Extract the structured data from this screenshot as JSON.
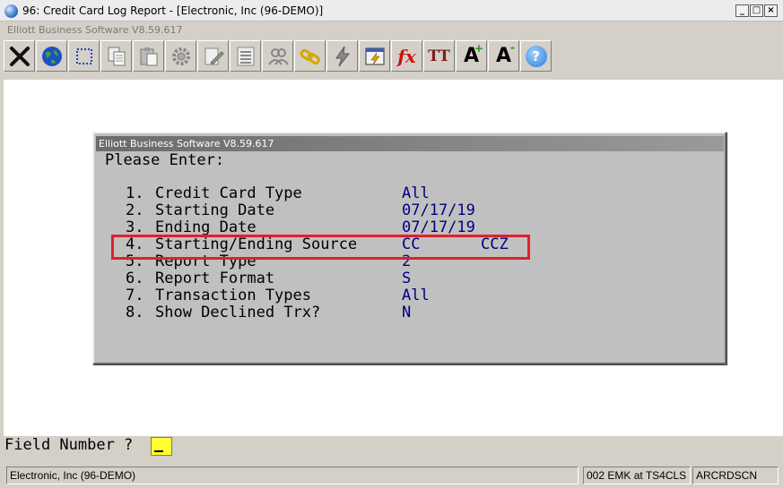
{
  "window": {
    "title": "96: Credit Card Log Report - [Electronic, Inc (96-DEMO)]",
    "subtitle": "Elliott Business Software V8.59.617",
    "buttons": {
      "minimize": "_",
      "maximize": "□",
      "close": "×"
    }
  },
  "toolbar": {
    "buttons": [
      {
        "icon": "close-x-icon"
      },
      {
        "icon": "globe-icon"
      },
      {
        "icon": "select-box-icon"
      },
      {
        "icon": "copy-icon"
      },
      {
        "icon": "paste-icon"
      },
      {
        "icon": "gear-icon"
      },
      {
        "icon": "edit-icon"
      },
      {
        "icon": "list-icon"
      },
      {
        "icon": "users-icon"
      },
      {
        "icon": "link-icon"
      },
      {
        "icon": "lightning-icon"
      },
      {
        "icon": "calendar-icon"
      },
      {
        "icon": "function-icon",
        "label": "fx"
      },
      {
        "icon": "font-size-icon",
        "label": "TT"
      },
      {
        "icon": "font-increase-icon",
        "label": "A"
      },
      {
        "icon": "font-decrease-icon",
        "label": "A"
      },
      {
        "icon": "help-icon",
        "label": "?"
      }
    ]
  },
  "dialog": {
    "title": "Elliott Business Software V8.59.617",
    "prompt": "Please Enter:",
    "fields": [
      {
        "num": "1.",
        "label": "Credit Card Type",
        "value": "All",
        "value2": ""
      },
      {
        "num": "2.",
        "label": "Starting Date",
        "value": "07/17/19",
        "value2": ""
      },
      {
        "num": "3.",
        "label": "Ending Date",
        "value": "07/17/19",
        "value2": ""
      },
      {
        "num": "4.",
        "label": "Starting/Ending Source",
        "value": "CC",
        "value2": "CCZ"
      },
      {
        "num": "5.",
        "label": "Report Type",
        "value": "2",
        "value2": ""
      },
      {
        "num": "6.",
        "label": "Report Format",
        "value": "S",
        "value2": ""
      },
      {
        "num": "7.",
        "label": "Transaction Types",
        "value": "All",
        "value2": ""
      },
      {
        "num": "8.",
        "label": "Show Declined Trx?",
        "value": "N",
        "value2": ""
      }
    ]
  },
  "field_prompt": {
    "label": "Field Number ?",
    "value": ""
  },
  "status": {
    "company": "Electronic, Inc (96-DEMO)",
    "user": "002 EMK at TS4CLS",
    "program": "ARCRDSCN"
  },
  "colors": {
    "highlight": "#e0202a",
    "value_text": "#000080",
    "input_bg": "#ffff33"
  }
}
